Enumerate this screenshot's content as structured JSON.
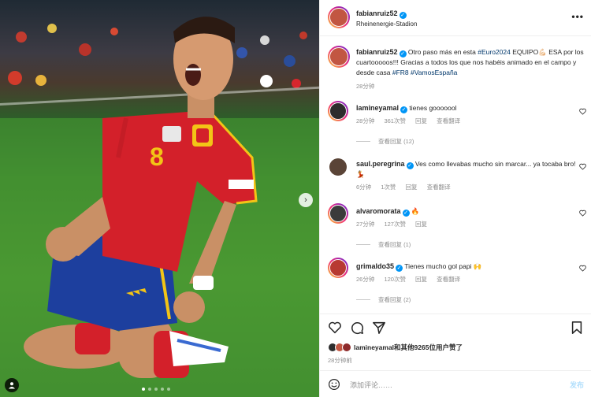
{
  "post": {
    "username": "fabianruiz52",
    "location": "Rheinenergie-Stadion",
    "caption": {
      "username": "fabianruiz52",
      "text_1": " Otro paso más en esta ",
      "hashtag_euro": "#Euro2024",
      "text_2": " EQUIPO",
      "text_3": " ESA por los cuartooooos!!! Gracias a todos los que nos habéis animado en el campo y desde casa ",
      "hashtag_fr8": "#FR8",
      "hashtag_vamos": "#VamosEspaña",
      "time": "28分钟"
    },
    "more_label": "•••"
  },
  "comments": [
    {
      "username": "lamineyamal",
      "text": "tienes gooooool",
      "time": "28分钟",
      "likes": "361次赞",
      "reply": "回复",
      "translate": "查看翻译",
      "view_replies": "查看回复 (12)"
    },
    {
      "username": "saul.peregrina",
      "text": "Ves como llevabas mucho sin marcar... ya tocaba bro! 💃",
      "time": "6分钟",
      "likes": "1次赞",
      "reply": "回复",
      "translate": "查看翻译"
    },
    {
      "username": "alvaromorata",
      "text": "🔥",
      "time": "27分钟",
      "likes": "127次赞",
      "reply": "回复",
      "view_replies": "查看回复 (1)"
    },
    {
      "username": "grimaldo35",
      "text": "Tienes mucho gol papi 🙌",
      "time": "26分钟",
      "likes": "120次赞",
      "reply": "回复",
      "translate": "查看翻译",
      "view_replies": "查看回复 (2)"
    }
  ],
  "likes": {
    "user": "lamineyamal",
    "text": "和其他9265位用户赞了"
  },
  "post_time": "28分钟前",
  "add_comment": {
    "placeholder": "添加评论……",
    "post": "发布"
  },
  "colors": {
    "link": "#00376b",
    "verified": "#0095f6",
    "muted": "#8e8e8e",
    "jersey_red": "#d3202a",
    "shorts_blue": "#1d3f9e"
  },
  "carousel": {
    "total": 5,
    "active": 0
  },
  "icons": [
    "heart-icon",
    "comment-icon",
    "share-icon",
    "bookmark-icon",
    "emoji-icon",
    "more-icon",
    "tag-user-icon",
    "next-arrow-icon"
  ]
}
